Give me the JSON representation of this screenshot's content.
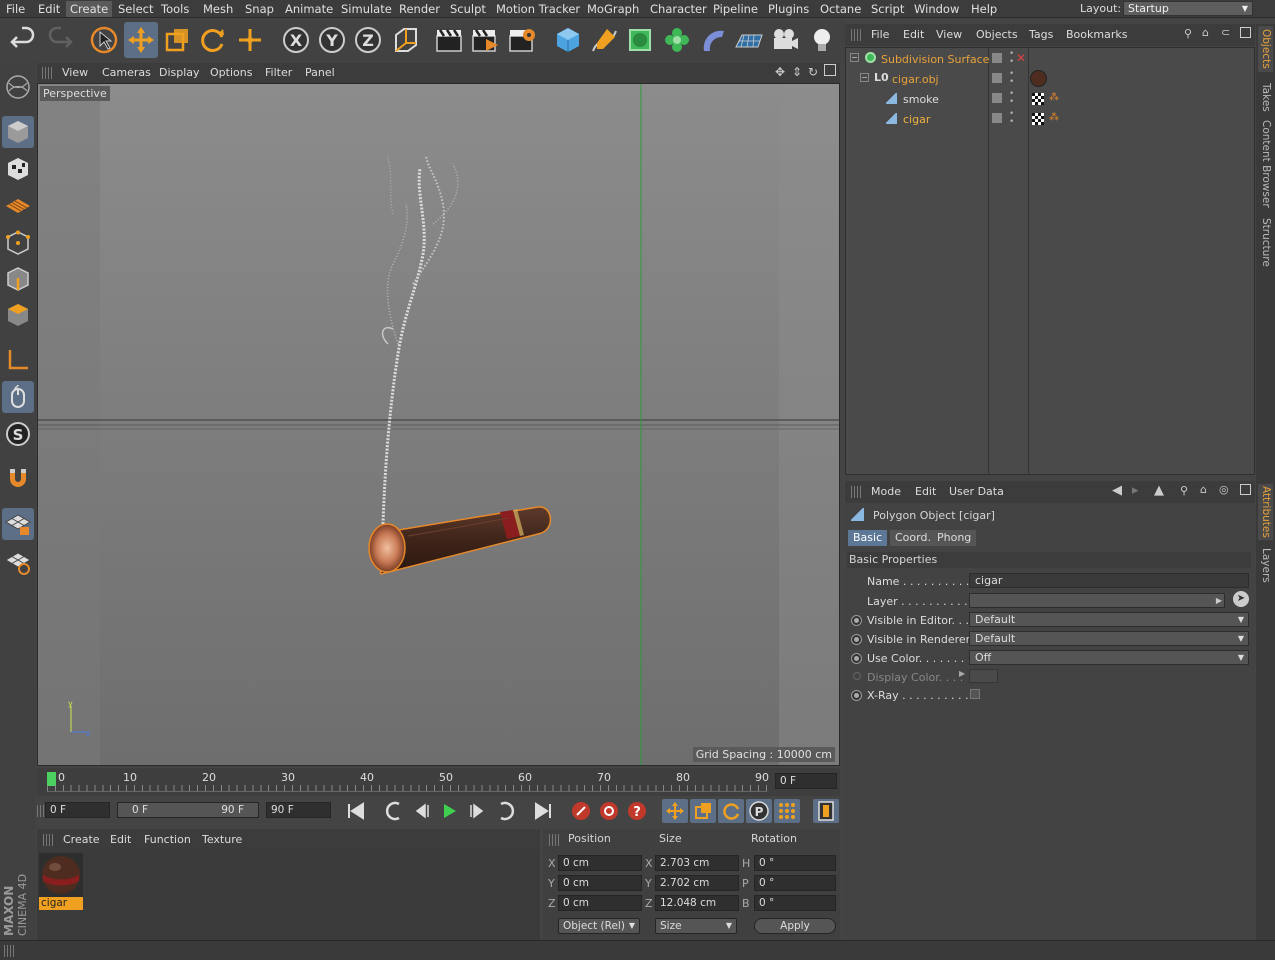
{
  "menubar": {
    "items": [
      "File",
      "Edit",
      "Create",
      "Select",
      "Tools",
      "Mesh",
      "Snap",
      "Animate",
      "Simulate",
      "Render",
      "Sculpt",
      "Motion Tracker",
      "MoGraph",
      "Character",
      "Pipeline",
      "Plugins",
      "Octane",
      "Script",
      "Window",
      "Help"
    ],
    "active": "Create",
    "layout_label": "Layout:",
    "layout_value": "Startup"
  },
  "viewport": {
    "menu": [
      "View",
      "Cameras",
      "Display",
      "Options",
      "Filter",
      "Panel"
    ],
    "camera_label": "Perspective",
    "grid_spacing": "Grid Spacing : 10000 cm"
  },
  "timeline": {
    "ticks": [
      "0",
      "10",
      "20",
      "30",
      "40",
      "50",
      "60",
      "70",
      "80",
      "90"
    ],
    "current_frame": "0 F",
    "start_field": "0 F",
    "range_start": "0 F",
    "range_end": "90 F",
    "end_field": "90 F"
  },
  "materials": {
    "menu": [
      "Create",
      "Edit",
      "Function",
      "Texture"
    ],
    "items": [
      {
        "name": "cigar"
      }
    ]
  },
  "coords": {
    "headers": {
      "position": "Position",
      "size": "Size",
      "rotation": "Rotation"
    },
    "rows": [
      {
        "axis": "X",
        "pos": "0 cm",
        "size": "2.703 cm",
        "rot_axis": "H",
        "rot": "0 °"
      },
      {
        "axis": "Y",
        "pos": "0 cm",
        "size": "2.702 cm",
        "rot_axis": "P",
        "rot": "0 °"
      },
      {
        "axis": "Z",
        "pos": "0 cm",
        "size": "12.048 cm",
        "rot_axis": "B",
        "rot": "0 °"
      }
    ],
    "mode_select": "Object (Rel)",
    "size_select": "Size",
    "apply": "Apply"
  },
  "objects": {
    "menu": [
      "File",
      "Edit",
      "View",
      "Objects",
      "Tags",
      "Bookmarks"
    ],
    "rows": [
      {
        "name": "Subdivision Surface",
        "color": "#e8a23b"
      },
      {
        "name": "cigar.obj",
        "color": "#e8a23b"
      },
      {
        "name": "smoke",
        "color": "#dddddd"
      },
      {
        "name": "cigar",
        "color": "#f0b040"
      }
    ]
  },
  "attributes": {
    "menu": [
      "Mode",
      "Edit",
      "User Data"
    ],
    "object_title": "Polygon Object [cigar]",
    "tabs": [
      "Basic",
      "Coord.",
      "Phong"
    ],
    "active_tab": "Basic",
    "section": "Basic Properties",
    "fields": {
      "name_label": "Name . . . . . . . . . . . .",
      "name_value": "cigar",
      "layer_label": "Layer . . . . . . . . . . . .",
      "vis_editor_label": "Visible in Editor. . .",
      "vis_editor_value": "Default",
      "vis_renderer_label": "Visible in Renderer",
      "vis_renderer_value": "Default",
      "use_color_label": "Use Color. . . . . . . .",
      "use_color_value": "Off",
      "display_color_label": "Display Color. . . .",
      "xray_label": "X-Ray . . . . . . . . . . ."
    }
  },
  "side_tabs": {
    "top": [
      "Objects",
      "Takes",
      "Content Browser",
      "Structure"
    ],
    "bottom": [
      "Attributes",
      "Layers"
    ]
  },
  "branding": {
    "line1": "MAXON",
    "line2": "CINEMA 4D"
  }
}
